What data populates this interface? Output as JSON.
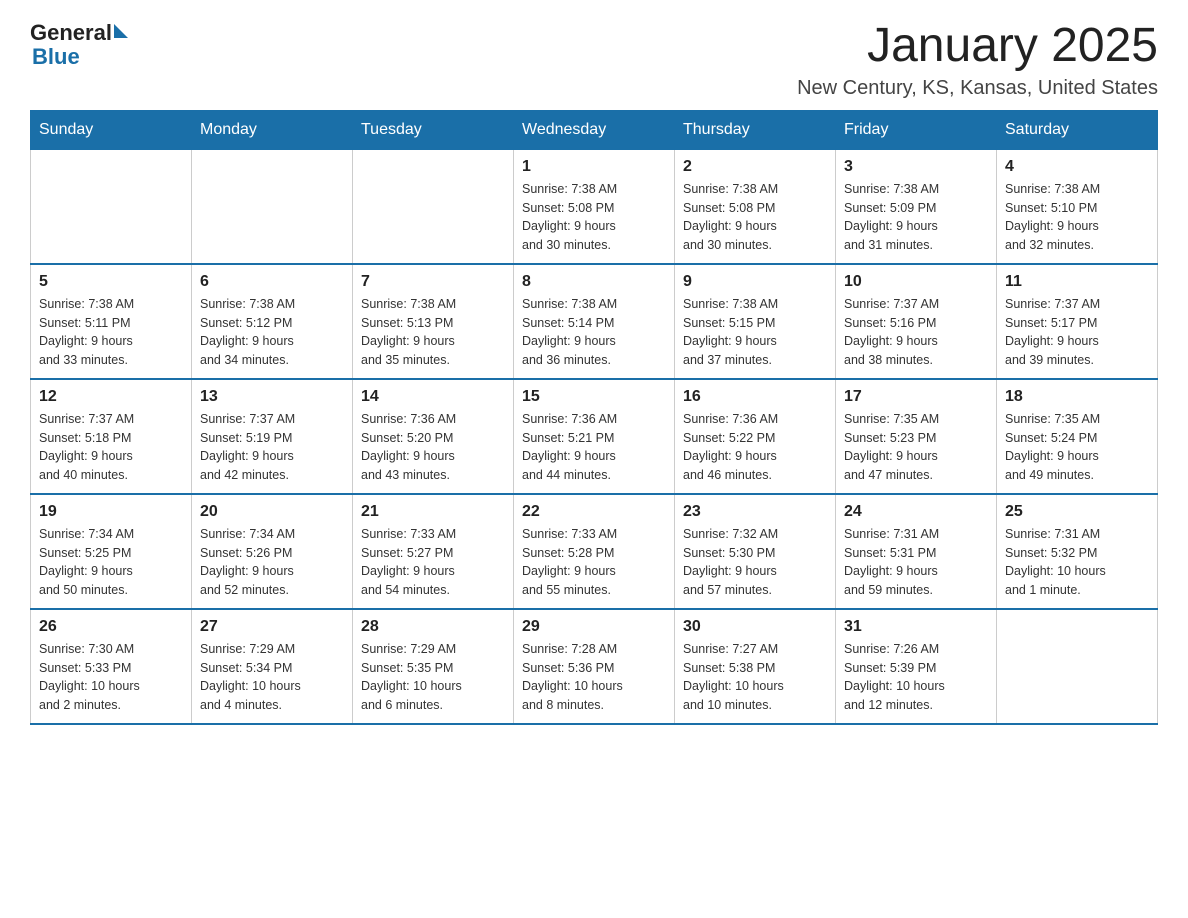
{
  "header": {
    "logo": {
      "text_general": "General",
      "triangle_label": "logo-triangle",
      "text_blue": "Blue"
    },
    "title": "January 2025",
    "subtitle": "New Century, KS, Kansas, United States"
  },
  "calendar": {
    "days_of_week": [
      "Sunday",
      "Monday",
      "Tuesday",
      "Wednesday",
      "Thursday",
      "Friday",
      "Saturday"
    ],
    "weeks": [
      [
        {
          "day": "",
          "info": ""
        },
        {
          "day": "",
          "info": ""
        },
        {
          "day": "",
          "info": ""
        },
        {
          "day": "1",
          "info": "Sunrise: 7:38 AM\nSunset: 5:08 PM\nDaylight: 9 hours\nand 30 minutes."
        },
        {
          "day": "2",
          "info": "Sunrise: 7:38 AM\nSunset: 5:08 PM\nDaylight: 9 hours\nand 30 minutes."
        },
        {
          "day": "3",
          "info": "Sunrise: 7:38 AM\nSunset: 5:09 PM\nDaylight: 9 hours\nand 31 minutes."
        },
        {
          "day": "4",
          "info": "Sunrise: 7:38 AM\nSunset: 5:10 PM\nDaylight: 9 hours\nand 32 minutes."
        }
      ],
      [
        {
          "day": "5",
          "info": "Sunrise: 7:38 AM\nSunset: 5:11 PM\nDaylight: 9 hours\nand 33 minutes."
        },
        {
          "day": "6",
          "info": "Sunrise: 7:38 AM\nSunset: 5:12 PM\nDaylight: 9 hours\nand 34 minutes."
        },
        {
          "day": "7",
          "info": "Sunrise: 7:38 AM\nSunset: 5:13 PM\nDaylight: 9 hours\nand 35 minutes."
        },
        {
          "day": "8",
          "info": "Sunrise: 7:38 AM\nSunset: 5:14 PM\nDaylight: 9 hours\nand 36 minutes."
        },
        {
          "day": "9",
          "info": "Sunrise: 7:38 AM\nSunset: 5:15 PM\nDaylight: 9 hours\nand 37 minutes."
        },
        {
          "day": "10",
          "info": "Sunrise: 7:37 AM\nSunset: 5:16 PM\nDaylight: 9 hours\nand 38 minutes."
        },
        {
          "day": "11",
          "info": "Sunrise: 7:37 AM\nSunset: 5:17 PM\nDaylight: 9 hours\nand 39 minutes."
        }
      ],
      [
        {
          "day": "12",
          "info": "Sunrise: 7:37 AM\nSunset: 5:18 PM\nDaylight: 9 hours\nand 40 minutes."
        },
        {
          "day": "13",
          "info": "Sunrise: 7:37 AM\nSunset: 5:19 PM\nDaylight: 9 hours\nand 42 minutes."
        },
        {
          "day": "14",
          "info": "Sunrise: 7:36 AM\nSunset: 5:20 PM\nDaylight: 9 hours\nand 43 minutes."
        },
        {
          "day": "15",
          "info": "Sunrise: 7:36 AM\nSunset: 5:21 PM\nDaylight: 9 hours\nand 44 minutes."
        },
        {
          "day": "16",
          "info": "Sunrise: 7:36 AM\nSunset: 5:22 PM\nDaylight: 9 hours\nand 46 minutes."
        },
        {
          "day": "17",
          "info": "Sunrise: 7:35 AM\nSunset: 5:23 PM\nDaylight: 9 hours\nand 47 minutes."
        },
        {
          "day": "18",
          "info": "Sunrise: 7:35 AM\nSunset: 5:24 PM\nDaylight: 9 hours\nand 49 minutes."
        }
      ],
      [
        {
          "day": "19",
          "info": "Sunrise: 7:34 AM\nSunset: 5:25 PM\nDaylight: 9 hours\nand 50 minutes."
        },
        {
          "day": "20",
          "info": "Sunrise: 7:34 AM\nSunset: 5:26 PM\nDaylight: 9 hours\nand 52 minutes."
        },
        {
          "day": "21",
          "info": "Sunrise: 7:33 AM\nSunset: 5:27 PM\nDaylight: 9 hours\nand 54 minutes."
        },
        {
          "day": "22",
          "info": "Sunrise: 7:33 AM\nSunset: 5:28 PM\nDaylight: 9 hours\nand 55 minutes."
        },
        {
          "day": "23",
          "info": "Sunrise: 7:32 AM\nSunset: 5:30 PM\nDaylight: 9 hours\nand 57 minutes."
        },
        {
          "day": "24",
          "info": "Sunrise: 7:31 AM\nSunset: 5:31 PM\nDaylight: 9 hours\nand 59 minutes."
        },
        {
          "day": "25",
          "info": "Sunrise: 7:31 AM\nSunset: 5:32 PM\nDaylight: 10 hours\nand 1 minute."
        }
      ],
      [
        {
          "day": "26",
          "info": "Sunrise: 7:30 AM\nSunset: 5:33 PM\nDaylight: 10 hours\nand 2 minutes."
        },
        {
          "day": "27",
          "info": "Sunrise: 7:29 AM\nSunset: 5:34 PM\nDaylight: 10 hours\nand 4 minutes."
        },
        {
          "day": "28",
          "info": "Sunrise: 7:29 AM\nSunset: 5:35 PM\nDaylight: 10 hours\nand 6 minutes."
        },
        {
          "day": "29",
          "info": "Sunrise: 7:28 AM\nSunset: 5:36 PM\nDaylight: 10 hours\nand 8 minutes."
        },
        {
          "day": "30",
          "info": "Sunrise: 7:27 AM\nSunset: 5:38 PM\nDaylight: 10 hours\nand 10 minutes."
        },
        {
          "day": "31",
          "info": "Sunrise: 7:26 AM\nSunset: 5:39 PM\nDaylight: 10 hours\nand 12 minutes."
        },
        {
          "day": "",
          "info": ""
        }
      ]
    ]
  }
}
